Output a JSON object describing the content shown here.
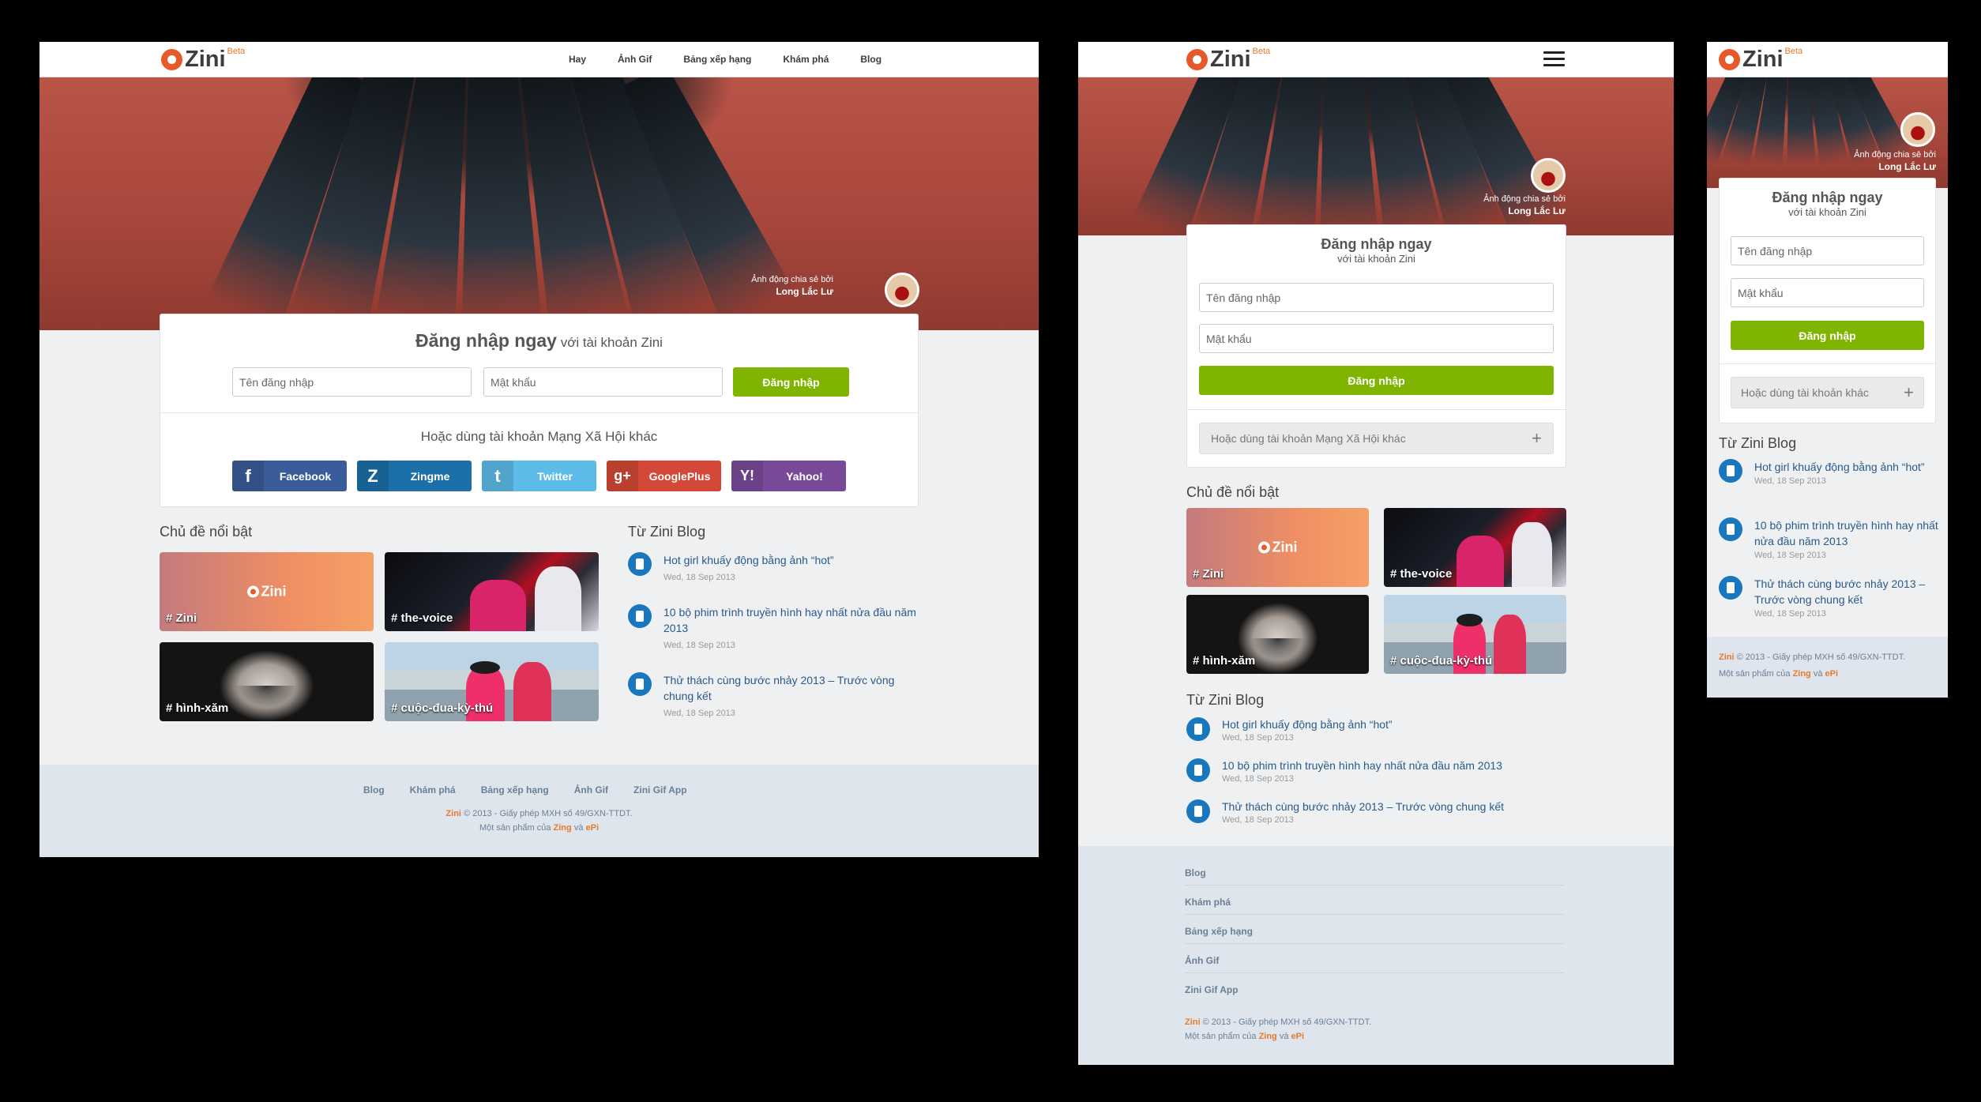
{
  "brand": {
    "name": "Zini",
    "beta": "Beta",
    "accent": "#e8592a",
    "green": "#7fb401",
    "blog_blue": "#1877bd"
  },
  "nav": [
    "Hay",
    "Ảnh Gif",
    "Bảng xếp hạng",
    "Khám phá",
    "Blog"
  ],
  "hero": {
    "credit_line": "Ảnh động chia sẻ bởi",
    "credit_name": "Long Lắc Lư"
  },
  "login": {
    "title_bold": "Đăng nhập ngay",
    "title_rest": "với tài khoản Zini",
    "username_placeholder": "Tên đăng nhập",
    "password_placeholder": "Mật khẩu",
    "submit": "Đăng nhập",
    "social_heading": "Hoặc dùng tài khoản Mạng Xã Hội khác",
    "other_accounts": "Hoặc dùng tài khoản khác",
    "other_plus": "+"
  },
  "social": [
    {
      "label": "Facebook",
      "icon": "f",
      "color": "#3b5c9a"
    },
    {
      "label": "Zingme",
      "icon": "Z",
      "color": "#1c6fa8"
    },
    {
      "label": "Twitter",
      "icon": "t",
      "color": "#5dbbe8"
    },
    {
      "label": "GooglePlus",
      "icon": "g+",
      "color": "#d34836"
    },
    {
      "label": "Yahoo!",
      "icon": "Y!",
      "color": "#7a4a9a"
    }
  ],
  "topics": {
    "heading": "Chủ đề nổi bật",
    "zini_logo": "Zini",
    "items": [
      "# Zini",
      "# the-voice",
      "# hình-xăm",
      "# cuộc-đua-kỳ-thú"
    ]
  },
  "blog": {
    "heading": "Từ Zini Blog",
    "posts": [
      {
        "title": "Hot girl khuấy động bằng ảnh “hot”",
        "date": "Wed, 18 Sep 2013"
      },
      {
        "title": "10 bộ phim trình truyền hình hay nhất nửa đầu năm 2013",
        "date": "Wed, 18 Sep 2013"
      },
      {
        "title": "Thử thách cùng bước nhảy 2013 – Trước vòng chung kết",
        "date": "Wed, 18 Sep 2013"
      }
    ]
  },
  "footer": {
    "links": [
      "Blog",
      "Khám phá",
      "Bảng xếp hạng",
      "Ảnh Gif",
      "Zini Gif App"
    ],
    "brand": "Zini",
    "copyright": "© 2013 - Giấy phép MXH số 49/GXN-TTDT.",
    "product_prefix": "Một sản phẩm của",
    "zing": "Zing",
    "and": "và",
    "epi": "ePi"
  }
}
